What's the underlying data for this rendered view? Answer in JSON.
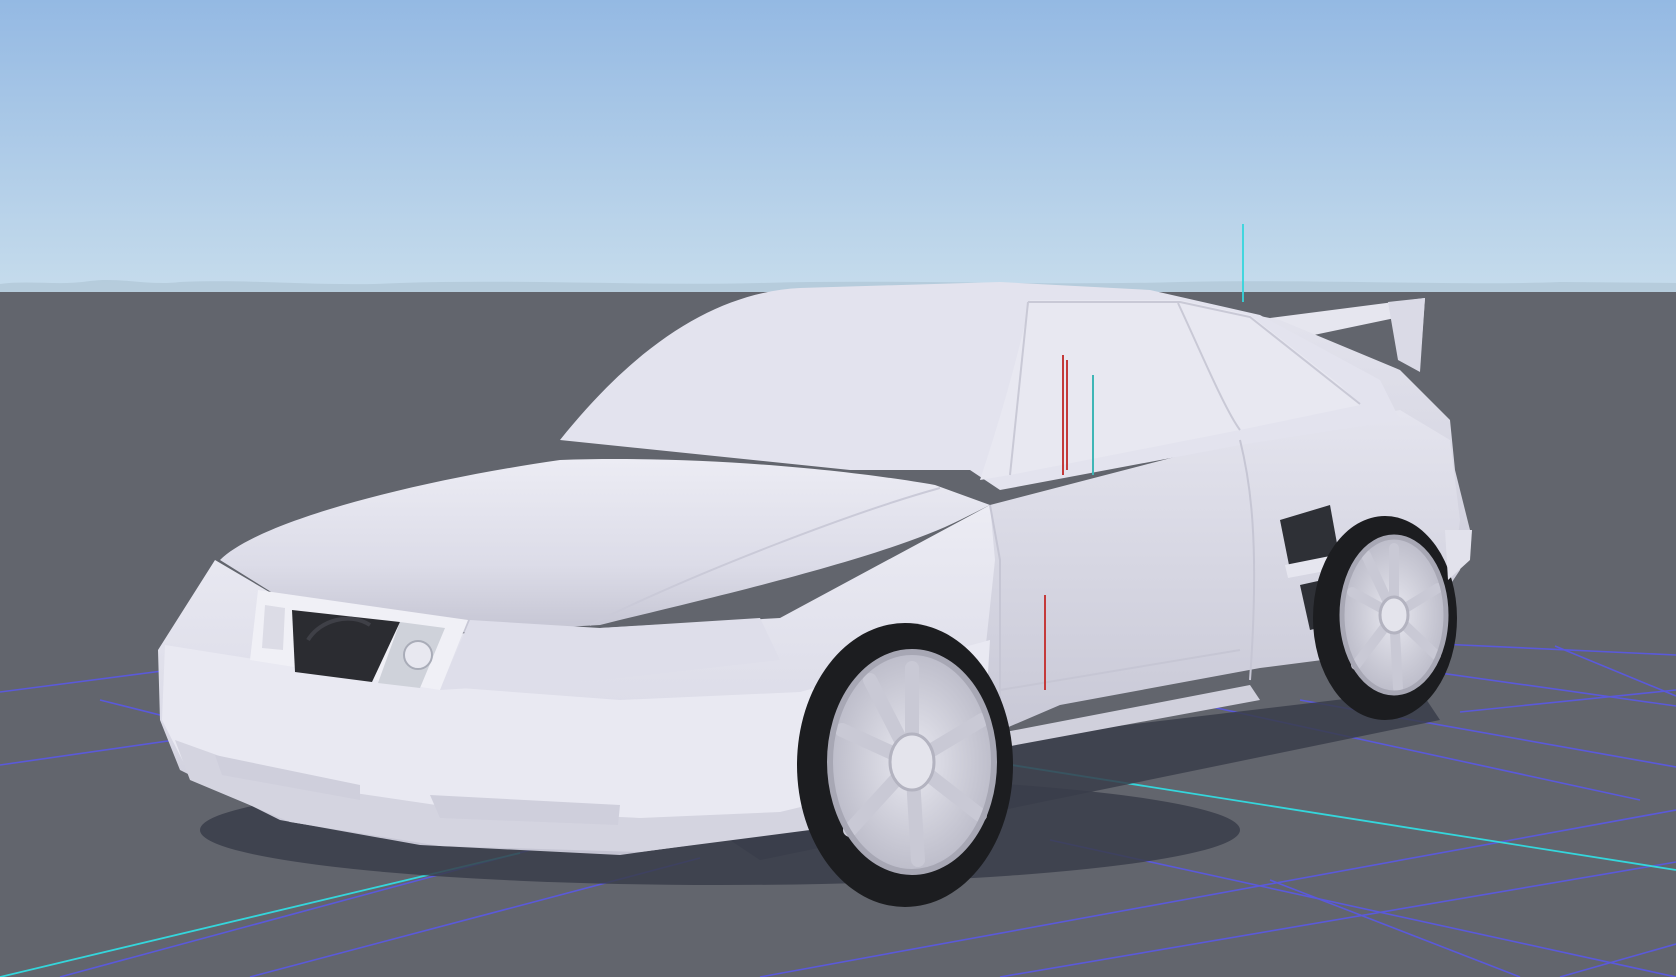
{
  "viewport": {
    "sky_top_color": "#94b9e3",
    "sky_horizon_color": "#c6dcec",
    "ground_color": "#62656d",
    "grid_color": "#5a58e6",
    "axis_x_color": "#34d6dc",
    "axis_y_color": "#34d6dc",
    "model_color": "#e3e3ee"
  }
}
